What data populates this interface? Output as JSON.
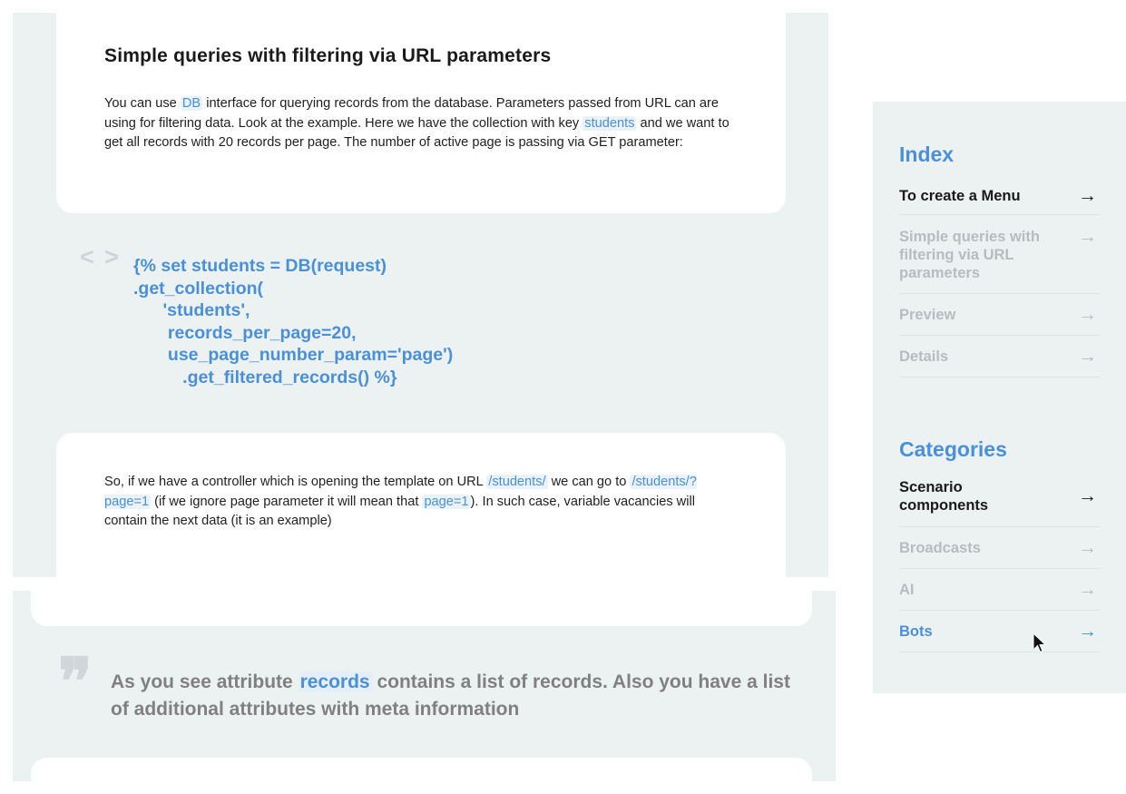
{
  "article": {
    "section_title": "Simple queries with filtering via URL parameters",
    "para1": {
      "t1": "You can use ",
      "hl1": "DB",
      "t2": " interface for querying records from the database. Parameters passed from URL can are using for filtering data. Look at the example. Here we have the collection with key ",
      "hl2": "students",
      "t3": " and we want to get all records with 20 records per page. The number of active page is passing via GET parameter:"
    },
    "code_icon": "< >",
    "code_lines": [
      "{% set students = DB(request)",
      ".get_collection(",
      "      'students',",
      "       records_per_page=20,",
      "       use_page_number_param='page')",
      "          .get_filtered_records() %}"
    ],
    "para2": {
      "t1": "So, if we have a controller which is opening the template on URL ",
      "hl1": "/students/",
      "t2": " we can go to ",
      "hl2": "/students/?page=1",
      "t3": " (if we ignore page parameter it will mean that ",
      "hl3": "page=1",
      "t4": "). In such case, variable vacancies will contain the next data (it is an example)"
    },
    "quote": {
      "t1": "As you see attribute ",
      "hl": "records",
      "t2": " contains a list of records. Also you have a list of additional attributes with meta information"
    }
  },
  "sidebar": {
    "index_title": "Index",
    "index_items": [
      {
        "label": "To create a Menu",
        "arrow": "→"
      },
      {
        "label": "Simple queries with filtering via URL parameters",
        "arrow": "→"
      },
      {
        "label": "Preview",
        "arrow": "→"
      },
      {
        "label": "Details",
        "arrow": "→"
      }
    ],
    "categories_title": "Categories",
    "category_items": [
      {
        "label": "Scenario components",
        "arrow": "→"
      },
      {
        "label": "Broadcasts",
        "arrow": "→"
      },
      {
        "label": "AI",
        "arrow": "→"
      },
      {
        "label": "Bots",
        "arrow": "→"
      }
    ]
  },
  "colors": {
    "accent": "#4a90d9",
    "panel": "#ecf1f2",
    "muted": "#b7bcc1"
  }
}
